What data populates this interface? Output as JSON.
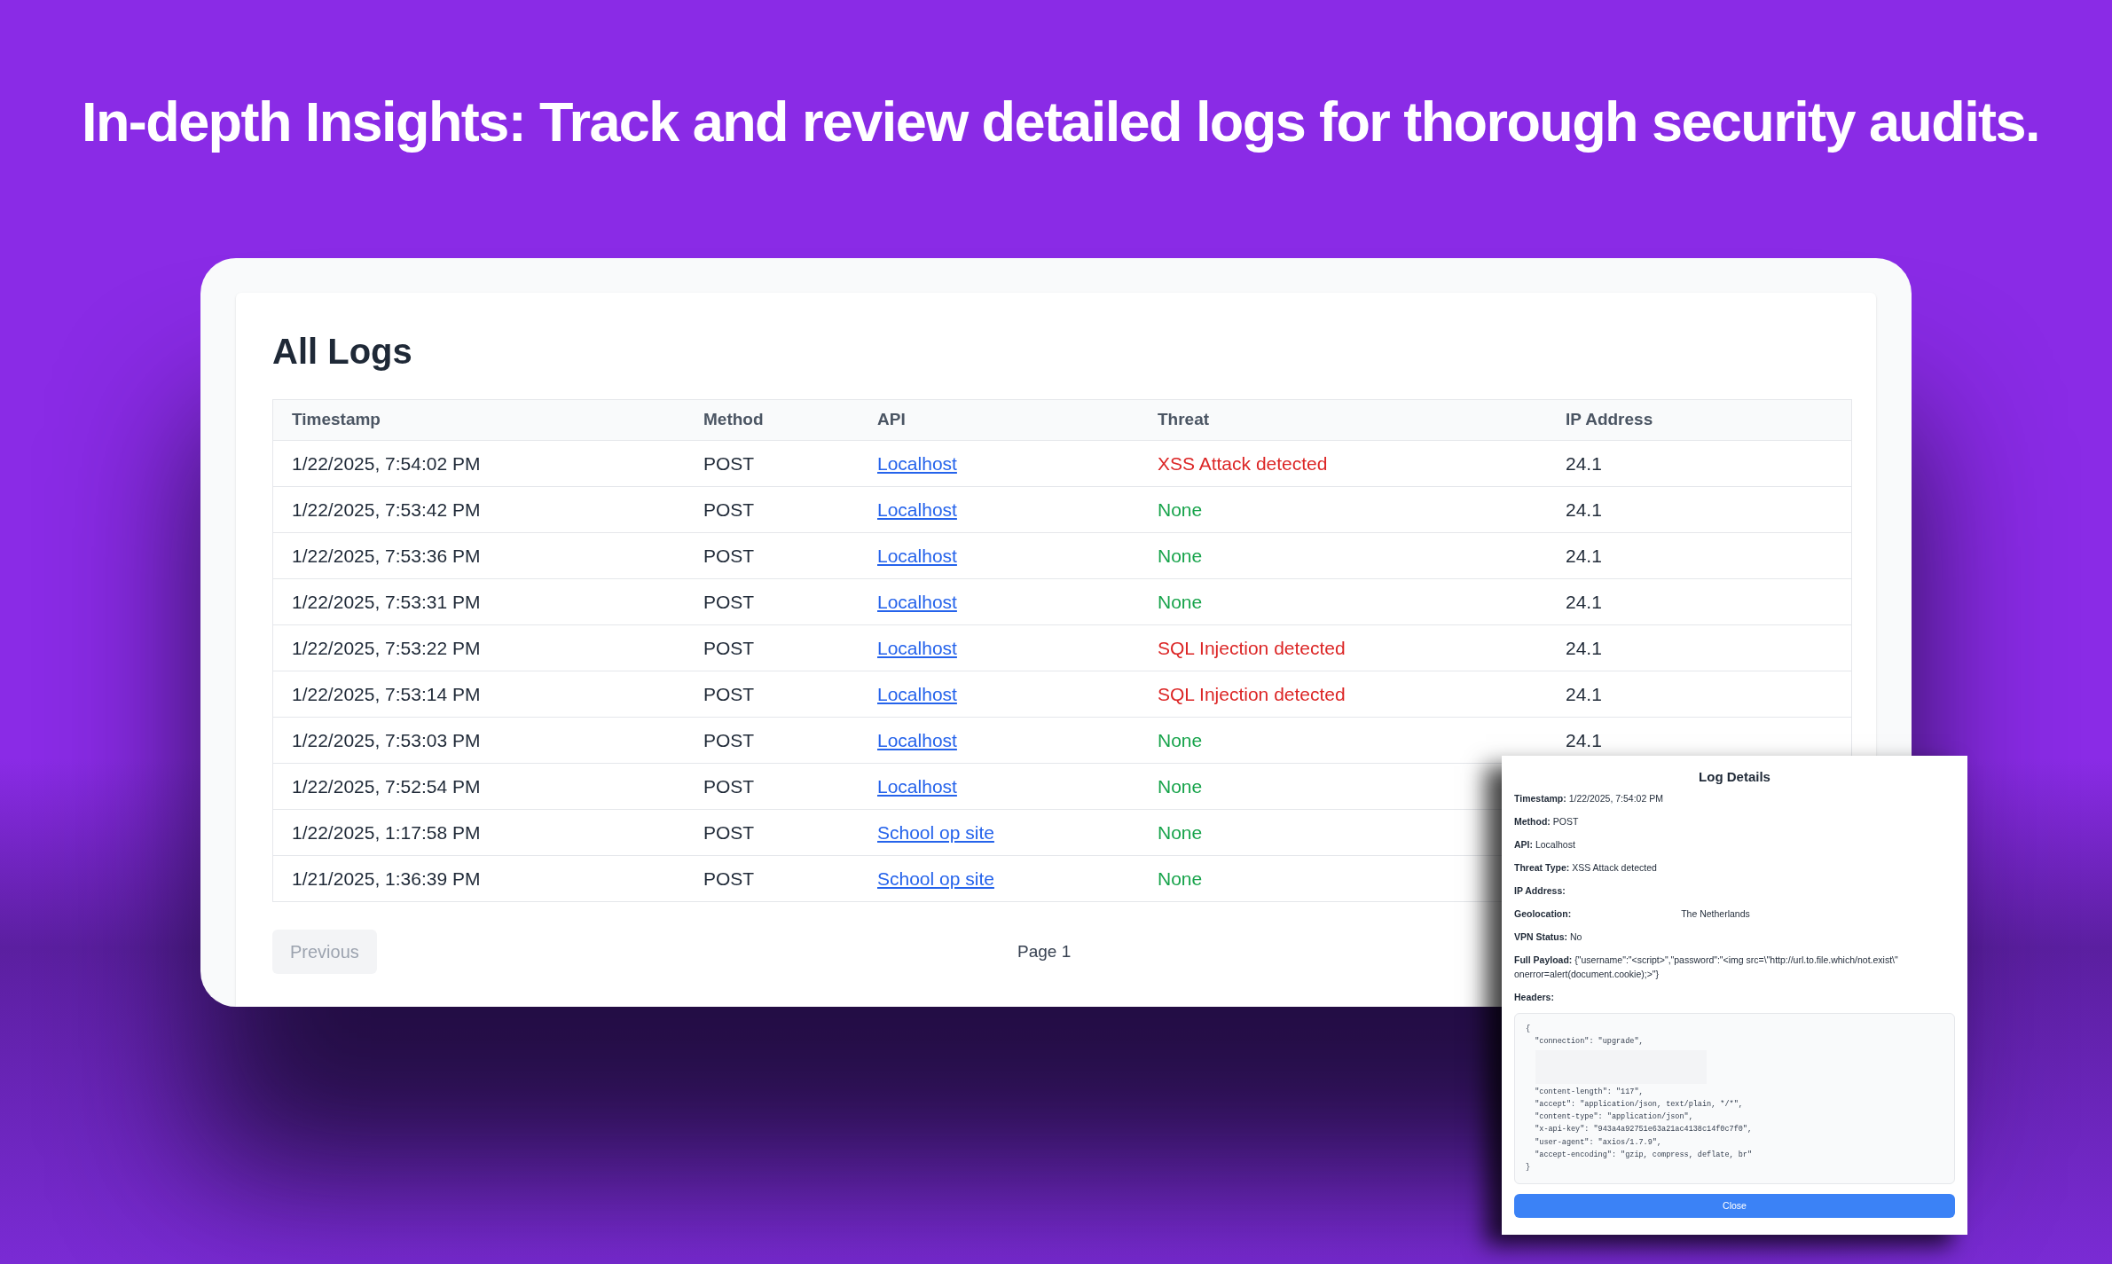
{
  "headline": "In-depth Insights: Track and review detailed logs for thorough security audits.",
  "logs": {
    "title": "All Logs",
    "columns": [
      "Timestamp",
      "Method",
      "API",
      "Threat",
      "IP Address"
    ],
    "rows": [
      {
        "timestamp": "1/22/2025, 7:54:02 PM",
        "method": "POST",
        "api": "Localhost",
        "threat": "XSS Attack detected",
        "is_threat": true,
        "ip": "24.1"
      },
      {
        "timestamp": "1/22/2025, 7:53:42 PM",
        "method": "POST",
        "api": "Localhost",
        "threat": "None",
        "is_threat": false,
        "ip": "24.1"
      },
      {
        "timestamp": "1/22/2025, 7:53:36 PM",
        "method": "POST",
        "api": "Localhost",
        "threat": "None",
        "is_threat": false,
        "ip": "24.1"
      },
      {
        "timestamp": "1/22/2025, 7:53:31 PM",
        "method": "POST",
        "api": "Localhost",
        "threat": "None",
        "is_threat": false,
        "ip": "24.1"
      },
      {
        "timestamp": "1/22/2025, 7:53:22 PM",
        "method": "POST",
        "api": "Localhost",
        "threat": "SQL Injection detected",
        "is_threat": true,
        "ip": "24.1"
      },
      {
        "timestamp": "1/22/2025, 7:53:14 PM",
        "method": "POST",
        "api": "Localhost",
        "threat": "SQL Injection detected",
        "is_threat": true,
        "ip": "24.1"
      },
      {
        "timestamp": "1/22/2025, 7:53:03 PM",
        "method": "POST",
        "api": "Localhost",
        "threat": "None",
        "is_threat": false,
        "ip": "24.1"
      },
      {
        "timestamp": "1/22/2025, 7:52:54 PM",
        "method": "POST",
        "api": "Localhost",
        "threat": "None",
        "is_threat": false
      },
      {
        "timestamp": "1/22/2025, 1:17:58 PM",
        "method": "POST",
        "api": "School op site",
        "threat": "None",
        "is_threat": false
      },
      {
        "timestamp": "1/21/2025, 1:36:39 PM",
        "method": "POST",
        "api": "School op site",
        "threat": "None",
        "is_threat": false
      }
    ],
    "previous_button": {
      "label": "Previous",
      "disabled": true
    },
    "page_label": "Page 1"
  },
  "log_details": {
    "title": "Log Details",
    "fields": [
      {
        "label": "Timestamp:",
        "value": "1/22/2025, 7:54:02 PM"
      },
      {
        "label": "Method:",
        "value": "POST"
      },
      {
        "label": "API:",
        "value": "Localhost"
      },
      {
        "label": "Threat Type:",
        "value": "XSS Attack detected"
      },
      {
        "label": "IP Address:"
      },
      {
        "label": "Geolocation:",
        "value": "The Netherlands",
        "redacted_gap": true
      },
      {
        "label": "VPN Status:",
        "value": "No"
      },
      {
        "label": "Full Payload:",
        "value": "{\"username\":\"<script>\",\"password\":\"<img src=\\\"http://url.to.file.which/not.exist\\\" onerror=alert(document.cookie);>\"}"
      }
    ],
    "headers_label": "Headers:",
    "headers_lines": [
      {
        "kind": "line",
        "text": "{"
      },
      {
        "kind": "line",
        "text": "  \"connection\": \"upgrade\","
      },
      {
        "kind": "redacted"
      },
      {
        "kind": "line",
        "text": "  \"content-length\": \"117\","
      },
      {
        "kind": "line",
        "text": "  \"accept\": \"application/json, text/plain, */*\","
      },
      {
        "kind": "line",
        "text": "  \"content-type\": \"application/json\","
      },
      {
        "kind": "line",
        "text": "  \"x-api-key\": \"943a4a92751e63a21ac4138c14f0c7f0\","
      },
      {
        "kind": "line",
        "text": "  \"user-agent\": \"axios/1.7.9\","
      },
      {
        "kind": "line",
        "text": "  \"accept-encoding\": \"gzip, compress, deflate, br\""
      },
      {
        "kind": "line",
        "text": "}"
      }
    ],
    "close_button": "Close"
  }
}
